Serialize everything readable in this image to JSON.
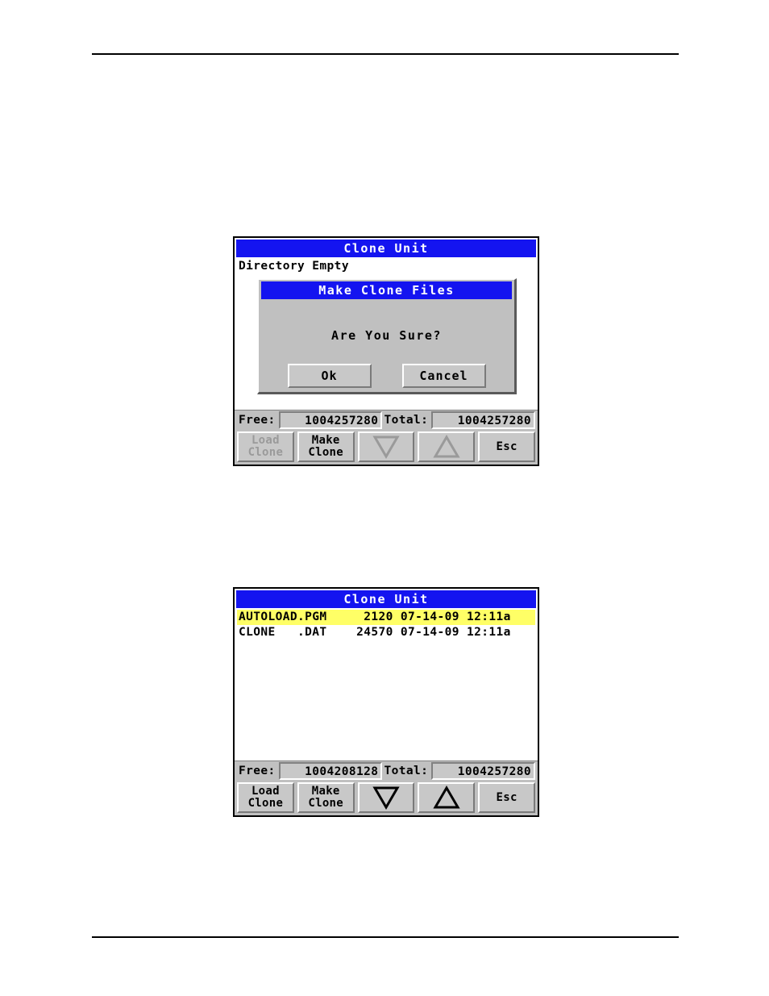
{
  "page": {
    "background": "#ffffff",
    "rule_color": "#000000"
  },
  "colors": {
    "titlebar_blue": "#1414f0",
    "titlebar_text": "#ffffff",
    "selection_yellow": "#ffff66",
    "panel_gray": "#c0c0c0",
    "button_face": "#c8c8c8",
    "disabled_text": "#9a9a9a",
    "list_background": "#ffffff",
    "text": "#000000"
  },
  "figure1": {
    "title": "Clone Unit",
    "list": {
      "empty_message": "Directory Empty",
      "rows": []
    },
    "status": {
      "free_label": "Free:",
      "free_value": "1004257280",
      "total_label": "Total:",
      "total_value": "1004257280"
    },
    "buttons": [
      {
        "line1": "Load",
        "line2": "Clone",
        "icon": "",
        "enabled": false,
        "name": "load-clone-button"
      },
      {
        "line1": "Make",
        "line2": "Clone",
        "icon": "",
        "enabled": true,
        "name": "make-clone-button"
      },
      {
        "line1": "",
        "line2": "",
        "icon": "triangle-down-icon",
        "enabled": false,
        "name": "scroll-down-button"
      },
      {
        "line1": "",
        "line2": "",
        "icon": "triangle-up-icon",
        "enabled": false,
        "name": "scroll-up-button"
      },
      {
        "line1": "Esc",
        "line2": "",
        "icon": "",
        "enabled": true,
        "name": "esc-button"
      }
    ],
    "modal": {
      "title": "Make Clone Files",
      "message": "Are You Sure?",
      "ok_label": "Ok",
      "cancel_label": "Cancel"
    }
  },
  "figure2": {
    "title": "Clone Unit",
    "list": {
      "empty_message": "",
      "columns": [
        "name",
        "size",
        "date",
        "time"
      ],
      "rows": [
        {
          "name": "AUTOLOAD.PGM",
          "size": "2120",
          "date": "07-14-09",
          "time": "12:11a",
          "selected": true,
          "text": "AUTOLOAD.PGM     2120 07-14-09 12:11a"
        },
        {
          "name": "CLONE   .DAT",
          "size": "24570",
          "date": "07-14-09",
          "time": "12:11a",
          "selected": false,
          "text": "CLONE   .DAT    24570 07-14-09 12:11a"
        }
      ]
    },
    "status": {
      "free_label": "Free:",
      "free_value": "1004208128",
      "total_label": "Total:",
      "total_value": "1004257280"
    },
    "buttons": [
      {
        "line1": "Load",
        "line2": "Clone",
        "icon": "",
        "enabled": true,
        "name": "load-clone-button"
      },
      {
        "line1": "Make",
        "line2": "Clone",
        "icon": "",
        "enabled": true,
        "name": "make-clone-button"
      },
      {
        "line1": "",
        "line2": "",
        "icon": "triangle-down-icon",
        "enabled": true,
        "name": "scroll-down-button"
      },
      {
        "line1": "",
        "line2": "",
        "icon": "triangle-up-icon",
        "enabled": true,
        "name": "scroll-up-button"
      },
      {
        "line1": "Esc",
        "line2": "",
        "icon": "",
        "enabled": true,
        "name": "esc-button"
      }
    ]
  }
}
